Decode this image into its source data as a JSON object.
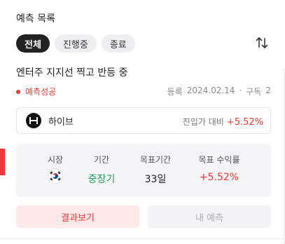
{
  "section": {
    "title": "예측 목록"
  },
  "filters": [
    {
      "label": "전체",
      "active": true
    },
    {
      "label": "진행중",
      "active": false
    },
    {
      "label": "종료",
      "active": false
    }
  ],
  "sort_icon": "sort-up-down-icon",
  "card": {
    "title": "엔터주 지지선 찍고 반등 중",
    "status": "예측성공",
    "registered_label": "등록",
    "registered_date": "2024.02.14",
    "separator": "·",
    "subscribers_label": "구독",
    "subscribers_count": "2",
    "stock": {
      "name": "하이브",
      "compare_label": "진입가 대비",
      "change": "+5.52%"
    },
    "stats": {
      "market_label": "시장",
      "market_flag": "south-korea-flag-icon",
      "period_label": "기간",
      "period_value": "중장기",
      "target_period_label": "목표기간",
      "target_period_value": "33일",
      "target_return_label": "목표 수익률",
      "target_return_value": "+5.52%"
    },
    "buttons": {
      "result": "결과보기",
      "mine": "내 예측"
    }
  },
  "colors": {
    "accent_red": "#e53935",
    "period_green": "#1e9c5a",
    "chip_active_bg": "#222222"
  }
}
